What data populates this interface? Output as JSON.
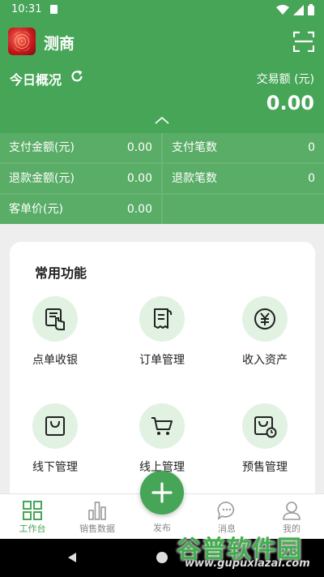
{
  "status": {
    "time": "10:31"
  },
  "header": {
    "app_name": "测商",
    "overview_title": "今日概况",
    "trade_label": "交易额 (元)",
    "trade_amount": "0.00"
  },
  "stats": [
    {
      "label": "支付金额(元)",
      "value": "0.00"
    },
    {
      "label": "支付笔数",
      "value": "0"
    },
    {
      "label": "退款金额(元)",
      "value": "0.00"
    },
    {
      "label": "退款笔数",
      "value": "0"
    },
    {
      "label": "客单价(元)",
      "value": "0.00"
    }
  ],
  "functions": {
    "title": "常用功能",
    "items": [
      {
        "label": "点单收银",
        "icon": "cashier-icon"
      },
      {
        "label": "订单管理",
        "icon": "receipt-icon"
      },
      {
        "label": "收入资产",
        "icon": "yuan-icon"
      },
      {
        "label": "线下管理",
        "icon": "shopping-bag-icon"
      },
      {
        "label": "线上管理",
        "icon": "shopping-cart-icon"
      },
      {
        "label": "预售管理",
        "icon": "presale-bag-icon"
      }
    ]
  },
  "tabbar": {
    "items": [
      {
        "label": "工作台",
        "icon": "grid-icon",
        "active": true
      },
      {
        "label": "销售数据",
        "icon": "bar-chart-icon"
      },
      {
        "label": "发布",
        "icon": "plus-icon"
      },
      {
        "label": "消息",
        "icon": "message-icon"
      },
      {
        "label": "我的",
        "icon": "person-icon"
      }
    ]
  },
  "watermark": {
    "text": "谷普软件园",
    "url": "www.gupuxlazai.com"
  },
  "colors": {
    "brand": "#46a557",
    "brand_light": "#e1f2e2"
  }
}
